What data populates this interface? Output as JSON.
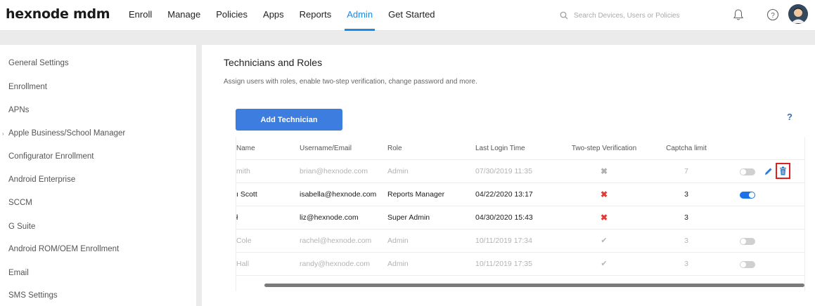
{
  "header": {
    "logo": "hexnode mdm",
    "nav": [
      "Enroll",
      "Manage",
      "Policies",
      "Apps",
      "Reports",
      "Admin",
      "Get Started"
    ],
    "active_nav": "Admin",
    "search_placeholder": "Search Devices, Users or Policies",
    "accent_color": "#1e88e5"
  },
  "sidebar": {
    "items": [
      "General Settings",
      "Enrollment",
      "APNs",
      "Apple Business/School Manager",
      "Configurator Enrollment",
      "Android Enterprise",
      "SCCM",
      "G Suite",
      "Android ROM/OEM Enrollment",
      "Email",
      "SMS Settings"
    ]
  },
  "main": {
    "title": "Technicians and Roles",
    "subtitle": "Assign users with roles, enable two-step verification, change password and more.",
    "add_button": "Add Technician",
    "help_label": "?",
    "columns": [
      "Name",
      "Username/Email",
      "Role",
      "Last Login Time",
      "Two-step Verification",
      "Captcha limit"
    ],
    "rows": [
      {
        "name": "mith",
        "email": "brian@hexnode.com",
        "role": "Admin",
        "login": "07/30/2019 11:35",
        "two_step": "✖",
        "captcha": "7"
      },
      {
        "name": "ı Scott",
        "email": "isabella@hexnode.com",
        "role": "Reports Manager",
        "login": "04/22/2020 13:17",
        "two_step": "✖",
        "captcha": "3"
      },
      {
        "name": "ł",
        "email": "liz@hexnode.com",
        "role": "Super Admin",
        "login": "04/30/2020 15:43",
        "two_step": "✖",
        "captcha": "3"
      },
      {
        "name": "Cole",
        "email": "rachel@hexnode.com",
        "role": "Admin",
        "login": "10/11/2019 17:34",
        "two_step": "✔",
        "captcha": "3"
      },
      {
        "name": "Hall",
        "email": "randy@hexnode.com",
        "role": "Admin",
        "login": "10/11/2019 17:35",
        "two_step": "✔",
        "captcha": "3"
      }
    ]
  }
}
